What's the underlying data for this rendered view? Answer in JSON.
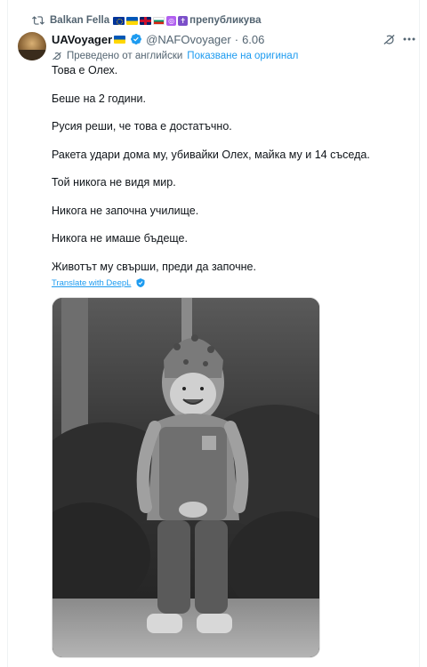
{
  "repost": {
    "user": "Balkan Fella",
    "label": "препубликува",
    "icon": "repost-icon",
    "flags": [
      "eu-flag",
      "ukraine-flag",
      "uk-flag",
      "bulgaria-flag"
    ],
    "emojis": [
      "camera-emoji",
      "cross-emoji"
    ]
  },
  "post": {
    "display_name": "UAVoyager",
    "handle": "@NAFOvoyager",
    "separator": "·",
    "time": "6.06",
    "translated_label": "Преведено от английски",
    "show_original_label": "Показване на оригинал",
    "paragraphs": [
      "Това е Олех.",
      "Беше на 2 години.",
      "Русия реши, че това е достатъчно.",
      "Ракета удари дома му, убивайки Олех, майка му и 14 съседа.",
      "Той никога не видя мир.",
      "Никога не започна училище.",
      "Никога не имаше бъдеще.",
      "Животът му свърши, преди да започне."
    ],
    "deepl_label": "Translate with DeepL"
  },
  "colors": {
    "accent": "#1d9bf0",
    "secondary_text": "#536471",
    "primary_text": "#0f1419",
    "verified": "#1d9bf0"
  }
}
